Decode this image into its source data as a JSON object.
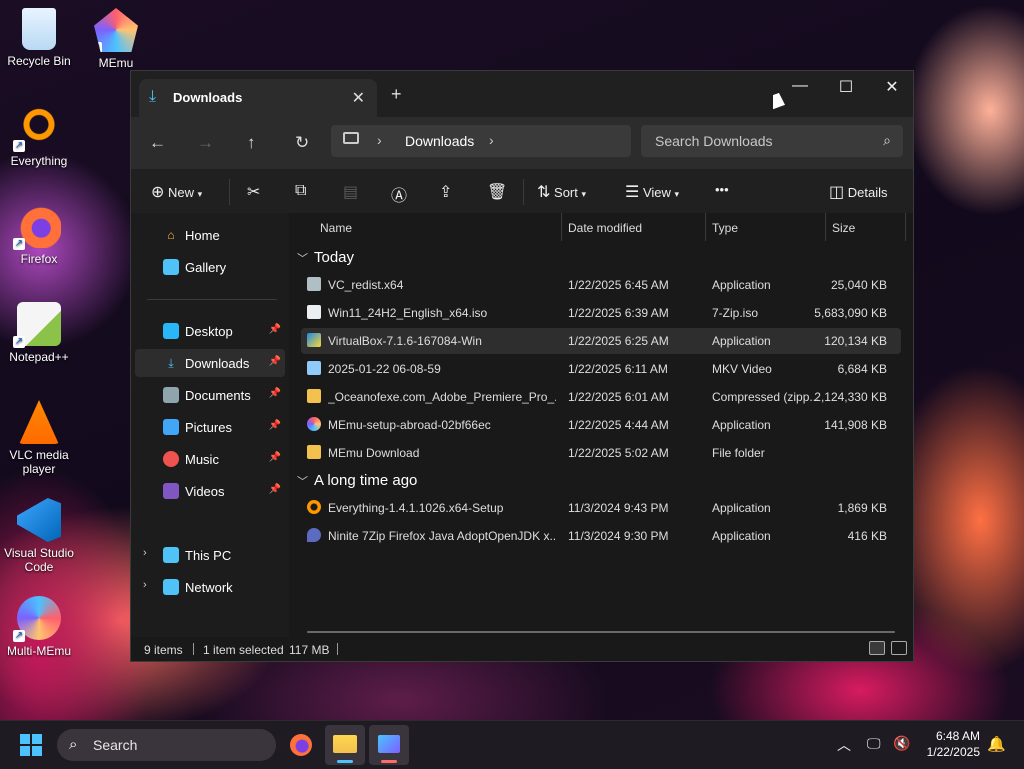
{
  "desktop": {
    "icons": [
      {
        "label": "Recycle Bin"
      },
      {
        "label": "MEmu"
      },
      {
        "label": "Everything"
      },
      {
        "label": "Firefox"
      },
      {
        "label": "Notepad++"
      },
      {
        "label": "VLC media player"
      },
      {
        "label": "Visual Studio Code"
      },
      {
        "label": "Multi-MEmu"
      }
    ]
  },
  "window": {
    "tab_title": "Downloads",
    "tab_close": "✕",
    "new_tab": "+",
    "minimize": "—",
    "maximize": "☐",
    "close": "✕",
    "breadcrumb": {
      "current": "Downloads"
    },
    "search_placeholder": "Search Downloads",
    "toolbar": {
      "new_label": "New",
      "sort_label": "Sort",
      "view_label": "View",
      "more_label": "•••",
      "details_label": "Details"
    },
    "sidebar": {
      "items": [
        {
          "label": "Home"
        },
        {
          "label": "Gallery"
        },
        {
          "label": "Desktop"
        },
        {
          "label": "Downloads"
        },
        {
          "label": "Documents"
        },
        {
          "label": "Pictures"
        },
        {
          "label": "Music"
        },
        {
          "label": "Videos"
        },
        {
          "label": "This PC"
        },
        {
          "label": "Network"
        }
      ],
      "selected": "Downloads"
    },
    "columns": [
      "Name",
      "Date modified",
      "Type",
      "Size"
    ],
    "groups": [
      {
        "label": "Today"
      },
      {
        "label": "A long time ago"
      }
    ],
    "files": [
      {
        "name": "VC_redist.x64",
        "date": "1/22/2025 6:45 AM",
        "type": "Application",
        "size": "25,040 KB"
      },
      {
        "name": "Win11_24H2_English_x64.iso",
        "date": "1/22/2025 6:39 AM",
        "type": "7-Zip.iso",
        "size": "5,683,090 KB"
      },
      {
        "name": "VirtualBox-7.1.6-167084-Win",
        "date": "1/22/2025 6:25 AM",
        "type": "Application",
        "size": "120,134 KB"
      },
      {
        "name": "2025-01-22 06-08-59",
        "date": "1/22/2025 6:11 AM",
        "type": "MKV Video",
        "size": "6,684 KB"
      },
      {
        "name": "_Oceanofexe.com_Adobe_Premiere_Pro_...",
        "date": "1/22/2025 6:01 AM",
        "type": "Compressed (zipp...",
        "size": "2,124,330 KB"
      },
      {
        "name": "MEmu-setup-abroad-02bf66ec",
        "date": "1/22/2025 4:44 AM",
        "type": "Application",
        "size": "141,908 KB"
      },
      {
        "name": "MEmu Download",
        "date": "1/22/2025 5:02 AM",
        "type": "File folder",
        "size": ""
      },
      {
        "name": "Everything-1.4.1.1026.x64-Setup",
        "date": "11/3/2024 9:43 PM",
        "type": "Application",
        "size": "1,869 KB"
      },
      {
        "name": "Ninite 7Zip Firefox Java AdoptOpenJDK x...",
        "date": "11/3/2024 9:30 PM",
        "type": "Application",
        "size": "416 KB"
      }
    ],
    "selected_file": "VirtualBox-7.1.6-167084-Win",
    "status": {
      "items": "9 items",
      "selection": "1 item selected",
      "size": "117 MB"
    }
  },
  "taskbar": {
    "search_placeholder": "Search",
    "time": "6:48 AM",
    "date": "1/22/2025"
  },
  "colors": {
    "accent": "#4cc2ff",
    "window_bg": "#191919",
    "folder": "#f2c14e"
  }
}
